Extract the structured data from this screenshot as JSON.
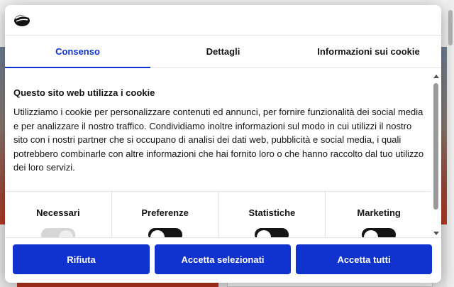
{
  "dialog": {
    "logo_icon": "cookiebot-logo-icon"
  },
  "tabs": [
    {
      "label": "Consenso",
      "active": true
    },
    {
      "label": "Dettagli",
      "active": false
    },
    {
      "label": "Informazioni sui cookie",
      "active": false
    }
  ],
  "content": {
    "heading": "Questo sito web utilizza i cookie",
    "body": "Utilizziamo i cookie per personalizzare contenuti ed annunci, per fornire funzionalità dei social media e per analizzare il nostro traffico. Condividiamo inoltre informazioni sul modo in cui utilizzi il nostro sito con i nostri partner che si occupano di analisi dei dati web, pubblicità e social media, i quali potrebbero combinarle con altre informazioni che hai fornito loro o che hanno raccolto dal tuo utilizzo dei loro servizi."
  },
  "categories": [
    {
      "label": "Necessari",
      "state": "on",
      "locked": true
    },
    {
      "label": "Preferenze",
      "state": "off",
      "locked": false
    },
    {
      "label": "Statistiche",
      "state": "off",
      "locked": false
    },
    {
      "label": "Marketing",
      "state": "off",
      "locked": false
    }
  ],
  "footer": {
    "reject_label": "Rifiuta",
    "accept_selected_label": "Accetta selezionati",
    "accept_all_label": "Accetta tutti"
  },
  "colors": {
    "accent": "#1032cf",
    "toggle_off": "#141414",
    "toggle_disabled": "#d6d6d6"
  }
}
